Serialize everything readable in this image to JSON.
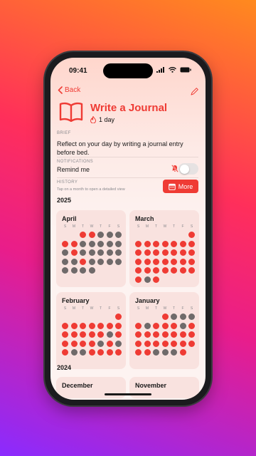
{
  "status": {
    "time": "09:41"
  },
  "nav": {
    "back_label": "Back"
  },
  "habit": {
    "title": "Write a Journal",
    "streak": "1 day"
  },
  "brief": {
    "label": "BRIEF",
    "text": "Reflect on your day by writing a journal entry before bed."
  },
  "notifications": {
    "label": "NOTIFICATIONS",
    "remind_label": "Remind me",
    "remind_on": false
  },
  "history": {
    "label": "HISTORY",
    "hint": "Tap on a month to open a detailed view",
    "more_label": "More"
  },
  "weekdays": [
    "S",
    "M",
    "T",
    "W",
    "T",
    "F",
    "S"
  ],
  "colors": {
    "accent": "#ef3b34",
    "done": "#ef3b34",
    "missed": "#6f6a6a"
  },
  "years": [
    {
      "year": "2025",
      "months": [
        {
          "name": "April",
          "start": 2,
          "days": [
            "r",
            "r",
            "g",
            "g",
            "g",
            "r",
            "r",
            "g",
            "g",
            "g",
            "g",
            "g",
            "g",
            "r",
            "g",
            "g",
            "g",
            "g",
            "g",
            "g",
            "g",
            "r",
            "g",
            "g",
            "g",
            "g",
            "g",
            "g",
            "g",
            "g"
          ]
        },
        {
          "name": "March",
          "start": 6,
          "days": [
            "r",
            "r",
            "r",
            "r",
            "r",
            "r",
            "r",
            "r",
            "r",
            "r",
            "r",
            "r",
            "r",
            "r",
            "r",
            "r",
            "r",
            "r",
            "r",
            "r",
            "r",
            "r",
            "r",
            "r",
            "r",
            "r",
            "r",
            "r",
            "r",
            "r",
            "g",
            "r"
          ]
        },
        {
          "name": "February",
          "start": 6,
          "days": [
            "r",
            "r",
            "r",
            "r",
            "r",
            "r",
            "r",
            "r",
            "r",
            "r",
            "r",
            "r",
            "r",
            "g",
            "r",
            "r",
            "r",
            "r",
            "r",
            "g",
            "r",
            "g",
            "r",
            "g",
            "g",
            "r",
            "r",
            "r",
            "r"
          ]
        },
        {
          "name": "January",
          "start": 3,
          "days": [
            "r",
            "g",
            "g",
            "g",
            "r",
            "g",
            "r",
            "r",
            "r",
            "g",
            "r",
            "r",
            "r",
            "r",
            "r",
            "r",
            "r",
            "r",
            "r",
            "r",
            "r",
            "r",
            "r",
            "r",
            "r",
            "r",
            "r",
            "g",
            "g",
            "g",
            "r"
          ]
        }
      ]
    },
    {
      "year": "2024",
      "months": [
        {
          "name": "December",
          "start": 0,
          "days": []
        },
        {
          "name": "November",
          "start": 5,
          "days": []
        }
      ]
    }
  ]
}
